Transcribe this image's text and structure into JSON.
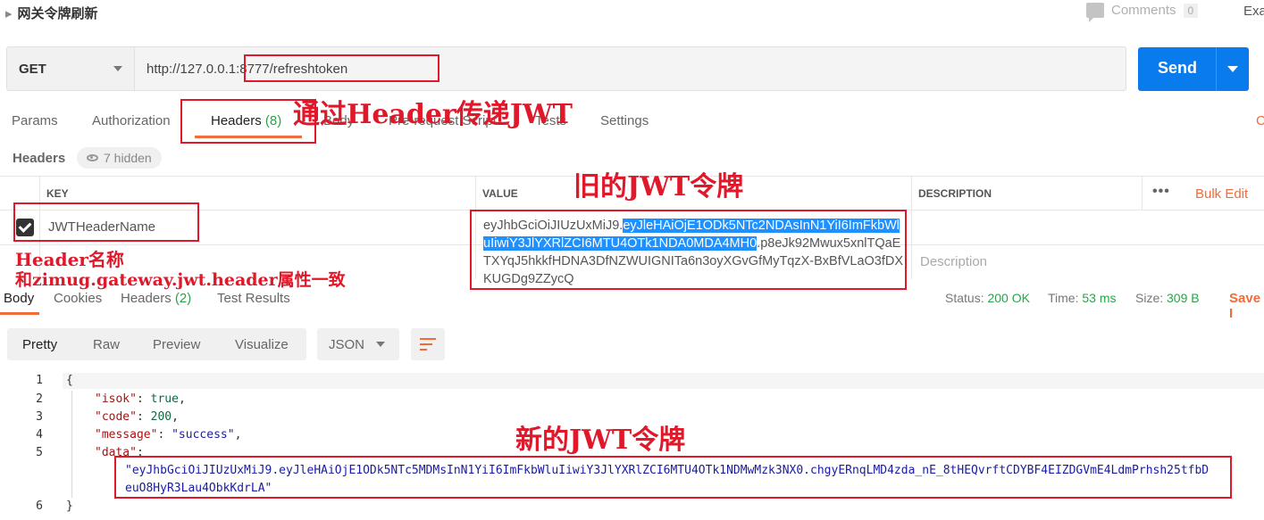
{
  "topbar": {
    "breadcrumb": "网关令牌刷新",
    "comments_label": "Comments",
    "comments_count": "0",
    "examples_label": "Exa"
  },
  "request": {
    "method": "GET",
    "url": "http://127.0.0.1:8777/refreshtoken",
    "send_label": "Send"
  },
  "request_tabs": {
    "params": "Params",
    "authorization": "Authorization",
    "headers": "Headers",
    "headers_count": "(8)",
    "body": "Body",
    "prerequest": "Pre-request Script",
    "tests": "Tests",
    "settings": "Settings",
    "cookies_partial": "C"
  },
  "headers_section": {
    "title": "Headers",
    "hidden": "7 hidden",
    "col_key": "KEY",
    "col_value": "VALUE",
    "col_description": "DESCRIPTION",
    "bulk_edit": "Bulk Edit",
    "row": {
      "key": "JWTHeaderName",
      "value_part1": "eyJhbGciOiJIUzUxMiJ9.",
      "value_selected": "eyJleHAiOjE1ODk5NTc2NDAsInN1YiI6ImFkbWluIiwiY3JlYXRlZCI6MTU4OTk1NDA0MDA4MH0",
      "value_part2": ".p8eJk92Mwux5xnlTQaETXYqJ5hkkfHDNA3DfNZWUIGNITa6n3oyXGvGfMyTqzX-BxBfVLaO3fDXKUGDg9ZZycQ",
      "checked": true
    },
    "description_placeholder": "Description"
  },
  "response": {
    "tabs": {
      "body": "Body",
      "cookies": "Cookies",
      "headers": "Headers",
      "headers_count": "(2)",
      "test_results": "Test Results"
    },
    "status_label": "Status:",
    "status_value": "200 OK",
    "time_label": "Time:",
    "time_value": "53 ms",
    "size_label": "Size:",
    "size_value": "309 B",
    "save": "Save I",
    "views": {
      "pretty": "Pretty",
      "raw": "Raw",
      "preview": "Preview",
      "visualize": "Visualize"
    },
    "format": "JSON"
  },
  "code": {
    "line_numbers": [
      "1",
      "2",
      "3",
      "4",
      "5",
      "6"
    ],
    "open_brace": "{",
    "close_brace": "}",
    "isok_key": "\"isok\"",
    "isok_val": "true",
    "code_key": "\"code\"",
    "code_val": "200",
    "message_key": "\"message\"",
    "message_val": "\"success\"",
    "data_key": "\"data\"",
    "data_val_line1": "\"eyJhbGciOiJIUzUxMiJ9.eyJleHAiOjE1ODk5NTc5MDMsInN1YiI6ImFkbWluIiwiY3JlYXRlZCI6MTU4OTk1NDMwMzk3NX0.chgyERnqLMD4zda_nE_8tHEQvrftCDYBF4EIZDGVmE4LdmPrhsh25tfbD",
    "data_val_line2": "euO8HyR3Lau4ObkKdrLA\""
  },
  "annotations": {
    "header_jwt": "通过Header传递JWT",
    "old_jwt": "旧的JWT令牌",
    "header_name": "Header名称",
    "header_consistent": "和zimug.gateway.jwt.header属性一致",
    "new_jwt": "新的JWT令牌"
  }
}
